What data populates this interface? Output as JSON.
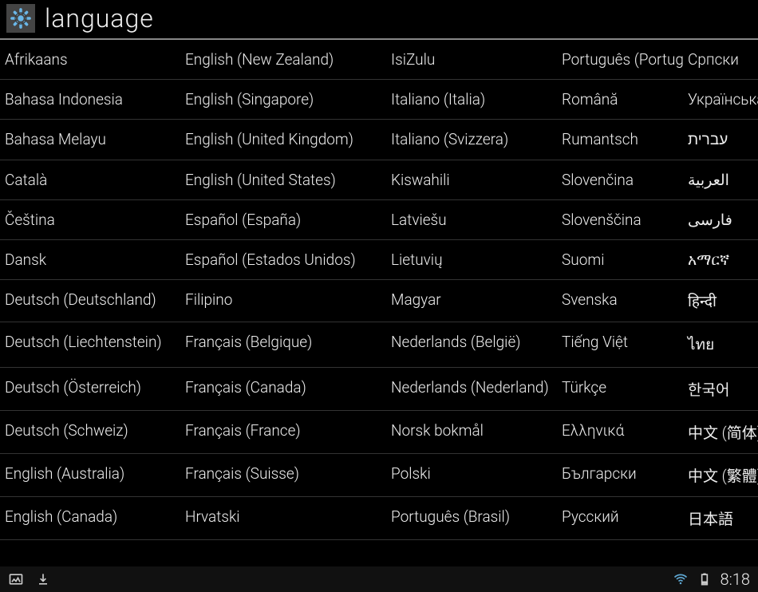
{
  "header": {
    "title": "language"
  },
  "languages": {
    "columns": [
      [
        "Afrikaans",
        "Bahasa Indonesia",
        "Bahasa Melayu",
        "Català",
        "Čeština",
        "Dansk",
        "Deutsch (Deutschland)",
        "Deutsch (Liechtenstein)",
        "Deutsch (Österreich)",
        "Deutsch (Schweiz)",
        "English (Australia)",
        "English (Canada)"
      ],
      [
        "English (New Zealand)",
        "English (Singapore)",
        "English (United Kingdom)",
        "English (United States)",
        "Español (España)",
        "Español (Estados Unidos)",
        "Filipino",
        "Français (Belgique)",
        "Français (Canada)",
        "Français (France)",
        "Français (Suisse)",
        "Hrvatski"
      ],
      [
        "IsiZulu",
        "Italiano (Italia)",
        "Italiano (Svizzera)",
        "Kiswahili",
        "Latviešu",
        "Lietuvių",
        "Magyar",
        "Nederlands (België)",
        "Nederlands (Nederland)",
        "Norsk bokmål",
        "Polski",
        "Português (Brasil)"
      ],
      [
        "Português (Portugal)",
        "Română",
        "Rumantsch",
        "Slovenčina",
        "Slovenščina",
        "Suomi",
        "Svenska",
        "Tiếng Việt",
        "Türkçe",
        "Ελληνικά",
        "Български",
        "Русский"
      ],
      [
        "Српски",
        "Українська",
        "עברית",
        "العربية",
        "فارسی",
        "አማርኛ",
        "हिन्दी",
        "ไทย",
        "한국어",
        "中文 (简体)",
        "中文 (繁體)",
        "日本語"
      ]
    ]
  },
  "statusbar": {
    "time": "8:18"
  }
}
